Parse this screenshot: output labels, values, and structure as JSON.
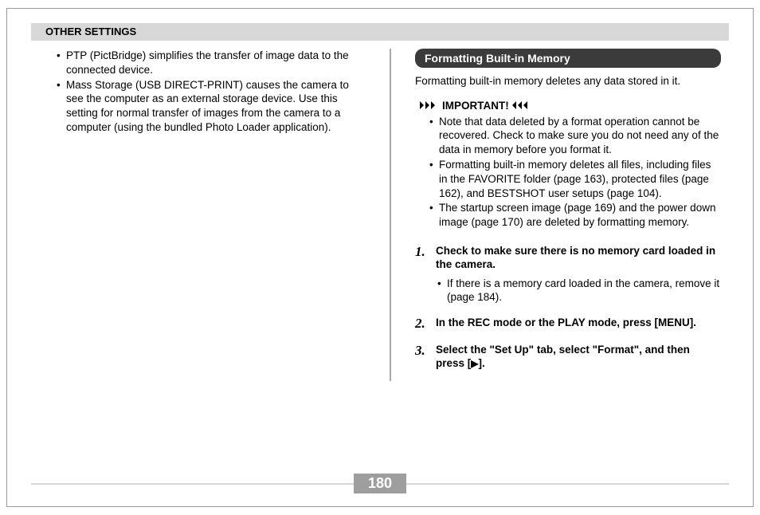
{
  "header": "OTHER SETTINGS",
  "left": {
    "bullets": [
      "PTP (PictBridge) simplifies the transfer of image data to the connected device.",
      "Mass Storage (USB DIRECT-PRINT) causes the camera to see the computer as an external storage device. Use this setting for normal transfer of images from the camera to a computer (using the bundled Photo Loader application)."
    ]
  },
  "right": {
    "section_title": "Formatting Built-in Memory",
    "intro": "Formatting built-in memory deletes any data stored in it.",
    "important_label": "IMPORTANT!",
    "important_items": [
      "Note that data deleted by a format operation cannot be recovered. Check to make sure you do not need any of the data in memory before you format it.",
      "Formatting built-in memory deletes all files, including files in the FAVORITE folder (page 163), protected files (page 162), and BESTSHOT user setups (page 104).",
      "The startup screen image (page 169) and the power down image (page 170) are deleted by formatting memory."
    ],
    "steps": [
      {
        "num": "1.",
        "text": "Check to make sure there is no memory card loaded in the camera.",
        "sub": [
          "If there is a memory card loaded in the camera, remove it (page 184)."
        ]
      },
      {
        "num": "2.",
        "text": "In the REC mode or the PLAY mode, press [MENU]."
      },
      {
        "num": "3.",
        "text_prefix": "Select the \"Set Up\" tab, select \"Format\", and then press [",
        "text_suffix": "]."
      }
    ]
  },
  "page_number": "180"
}
